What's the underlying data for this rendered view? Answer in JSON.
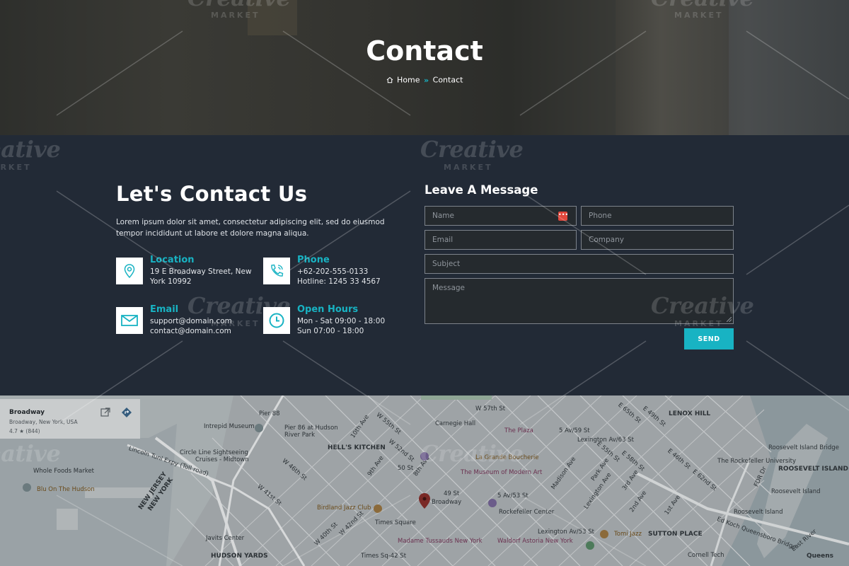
{
  "hero": {
    "title": "Contact",
    "breadcrumb": {
      "home": "Home",
      "separator": "»",
      "current": "Contact"
    }
  },
  "contact": {
    "heading": "Let's Contact Us",
    "intro": "Lorem ipsum dolor sit amet, consectetur adipiscing elit, sed do eiusmod tempor incididunt ut labore et dolore magna aliqua.",
    "items": [
      {
        "icon": "location-pin-icon",
        "title": "Location",
        "line1": "19 E Broadway Street, New",
        "line2": "York 10992"
      },
      {
        "icon": "phone-icon",
        "title": "Phone",
        "line1": "+62-202-555-0133",
        "line2": "Hotline: 1245 33 4567"
      },
      {
        "icon": "mail-icon",
        "title": "Email",
        "line1": "support@domain.com",
        "line2": "contact@domain.com"
      },
      {
        "icon": "clock-icon",
        "title": "Open Hours",
        "line1": "Mon - Sat 09:00 - 18:00",
        "line2": "Sun 07:00 - 18:00"
      }
    ]
  },
  "form": {
    "heading": "Leave A Message",
    "name_placeholder": "Name",
    "phone_placeholder": "Phone",
    "email_placeholder": "Email",
    "company_placeholder": "Company",
    "subject_placeholder": "Subject",
    "message_placeholder": "Message",
    "send_label": "SEND",
    "badge": "•••"
  },
  "map": {
    "place_title": "Broadway",
    "place_address": "Broadway, New York, USA",
    "rating": "4.7 ★ (844)",
    "labels": {
      "pier": "Pier 88",
      "intrepid": "Intrepid Museum",
      "pier86": "Pier 86 at Hudson",
      "river_park": "River Park",
      "hells_kitchen": "HELL'S KITCHEN",
      "lincoln": "Lincoln Tunl Expy (Toll road)",
      "circle_line": "Circle Line Sightseeing",
      "cruises": "Cruises - Midtown",
      "whole_foods": "Whole Foods Market",
      "blu": "Blu On The Hudson",
      "new_jersey": "NEW JERSEY",
      "new_york": "NEW YORK",
      "carnegie": "Carnegie Hall",
      "plaza": "The Plaza",
      "five_av": "5 Av/59 St",
      "lexington": "Lexington Av/63 St",
      "lenox": "LENOX HILL",
      "grande": "La Grande Boucherie",
      "moma": "The Museum of Modern Art",
      "fifty": "50 St",
      "fortynine": "49 St",
      "broadway_pin": "Broadway",
      "fiveav53": "5 Av/53 St",
      "rockefeller": "Rockefeller Center",
      "birdland": "Birdland Jazz Club",
      "times": "Times Square",
      "tussauds": "Madame Tussauds New York",
      "waldorf": "Waldorf Astoria New York",
      "tomi": "Tomi Jazz",
      "sutton": "SUTTON PLACE",
      "javits": "Javits Center",
      "hudson_yards": "HUDSON YARDS",
      "times_sq42": "Times Sq-42 St",
      "lex53": "Lexington Av/53 St",
      "rockefeller_univ": "The Rockefeller University",
      "roosevelt_bridge": "Roosevelt Island Bridge",
      "roosevelt": "ROOSEVELT ISLAND",
      "roosevelt_island": "Roosevelt Island",
      "tramway": "Roosevelt Island",
      "cornell": "Cornell Tech",
      "queensboro": "Ed Koch Queensboro Bridge",
      "w57": "W 57th St",
      "w55": "W 55th St",
      "w52": "W 52nd St",
      "w46": "W 46th St",
      "w41": "W 41st St",
      "w40": "W 40th St",
      "w42": "W 42nd St",
      "tenth": "10th Ave",
      "ninth": "9th Ave",
      "eighth": "8th Ave",
      "madison": "Madison Ave",
      "park": "Park Ave",
      "lex": "Lexington Ave",
      "third": "3rd Ave",
      "second": "2nd Ave",
      "first": "1st Ave",
      "e65": "E 65th St",
      "e62": "E 62nd St",
      "e58": "E 58th St",
      "e55": "E 55th St",
      "e49": "E 49th St",
      "e46": "E 46th St",
      "fdr": "FDR Dr",
      "east_river": "East River",
      "queens": "Queens"
    }
  },
  "watermark": {
    "brand": "Creative",
    "sub": "MARKET"
  }
}
